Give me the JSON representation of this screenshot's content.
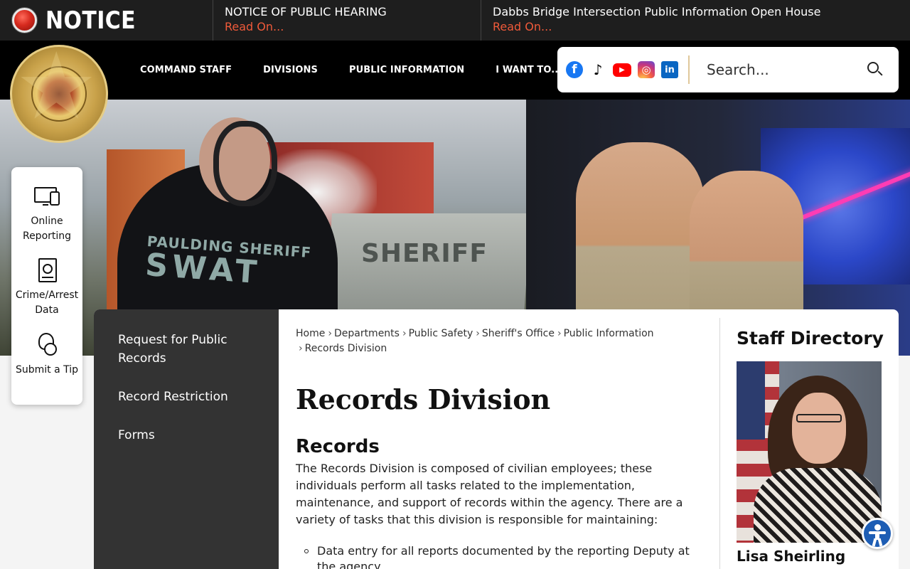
{
  "notice": {
    "label": "NOTICE",
    "items": [
      {
        "title": "NOTICE OF PUBLIC HEARING",
        "link": "Read On..."
      },
      {
        "title": "Dabbs Bridge Intersection Public Information Open House",
        "link": "Read On..."
      }
    ]
  },
  "header": {
    "nav": [
      "COMMAND STAFF",
      "DIVISIONS",
      "PUBLIC INFORMATION",
      "I WANT TO..."
    ],
    "social": [
      {
        "name": "facebook-icon",
        "glyph": "f"
      },
      {
        "name": "tiktok-icon",
        "glyph": "♪"
      },
      {
        "name": "youtube-icon",
        "glyph": "▶"
      },
      {
        "name": "instagram-icon",
        "glyph": "◎"
      },
      {
        "name": "linkedin-icon",
        "glyph": "in"
      }
    ],
    "search_placeholder": "Search..."
  },
  "hero": {
    "shirt_line1": "PAULDING SHERIFF",
    "shirt_line2": "SWAT",
    "vehicle_text": "SHERIFF"
  },
  "quick_links": [
    {
      "label": "Online Reporting",
      "icon": "monitor-icon"
    },
    {
      "label": "Crime/Arrest Data",
      "icon": "document-icon"
    },
    {
      "label": "Submit a Tip",
      "icon": "tip-icon"
    }
  ],
  "sidenav": [
    "Request for Public Records",
    "Record Restriction",
    "Forms"
  ],
  "breadcrumb": [
    "Home",
    "Departments",
    "Public Safety",
    "Sheriff's Office",
    "Public Information",
    "Records Division"
  ],
  "page": {
    "title": "Records Division",
    "section_title": "Records",
    "body": "The Records Division is composed of civilian employees; these individuals perform all tasks related to the implementation, maintenance, and support of records within the agency. There are a variety of tasks that this division is responsible for maintaining:",
    "bullets": [
      "Data entry for all reports documented by the reporting Deputy at the agency"
    ]
  },
  "staff": {
    "title": "Staff Directory",
    "name": "Lisa Sheirling"
  },
  "colors": {
    "accent_link": "#f05a3a",
    "sidenav_bg": "#333333",
    "a11y_blue": "#1d5db4"
  }
}
